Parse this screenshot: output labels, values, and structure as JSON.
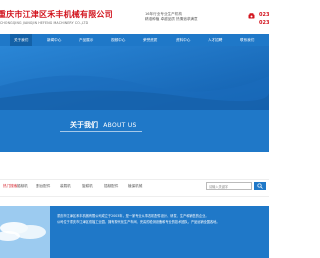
{
  "header": {
    "company_name": "重庆市江津区禾丰机械有限公司",
    "company_name_en": "CHONGQING JIANGJIN HEFENG MACHINERY CO.,LTD",
    "slogan_line1": "16年行业专业生产机构",
    "slogan_line2": "精准种植 卓越品质 热情追求满意",
    "phone_line1": "023",
    "phone_line2": "023"
  },
  "nav": {
    "items": [
      "关于我们",
      "新闻中心",
      "产品展示",
      "视频中心",
      "荣誉资质",
      "资料中心",
      "人才招聘",
      "联系我们"
    ]
  },
  "about_heading": {
    "zh": "关于我们",
    "en": "ABOUT US"
  },
  "category_bar": {
    "label": "热门搜索：",
    "items": [
      "插秧机",
      "割台配件",
      "装载机",
      "旋耕机",
      "插秧配件",
      "植保机械"
    ],
    "search_placeholder": "请输入关键字"
  },
  "about_text": {
    "line1": "重庆市江津区禾丰机械有限公司成立于2003年，是一家专业从事农机配件设计、研发、生产和销售的企业。",
    "line2": "公司位于重庆市江津区双福工业园，拥有现代化生产车间、完善的检测设备和专业的技术团队，产品远销全国各地。"
  },
  "colors": {
    "brand_red": "#d2141e",
    "nav_blue": "#1f78c8",
    "nav_active": "#1461a7"
  }
}
